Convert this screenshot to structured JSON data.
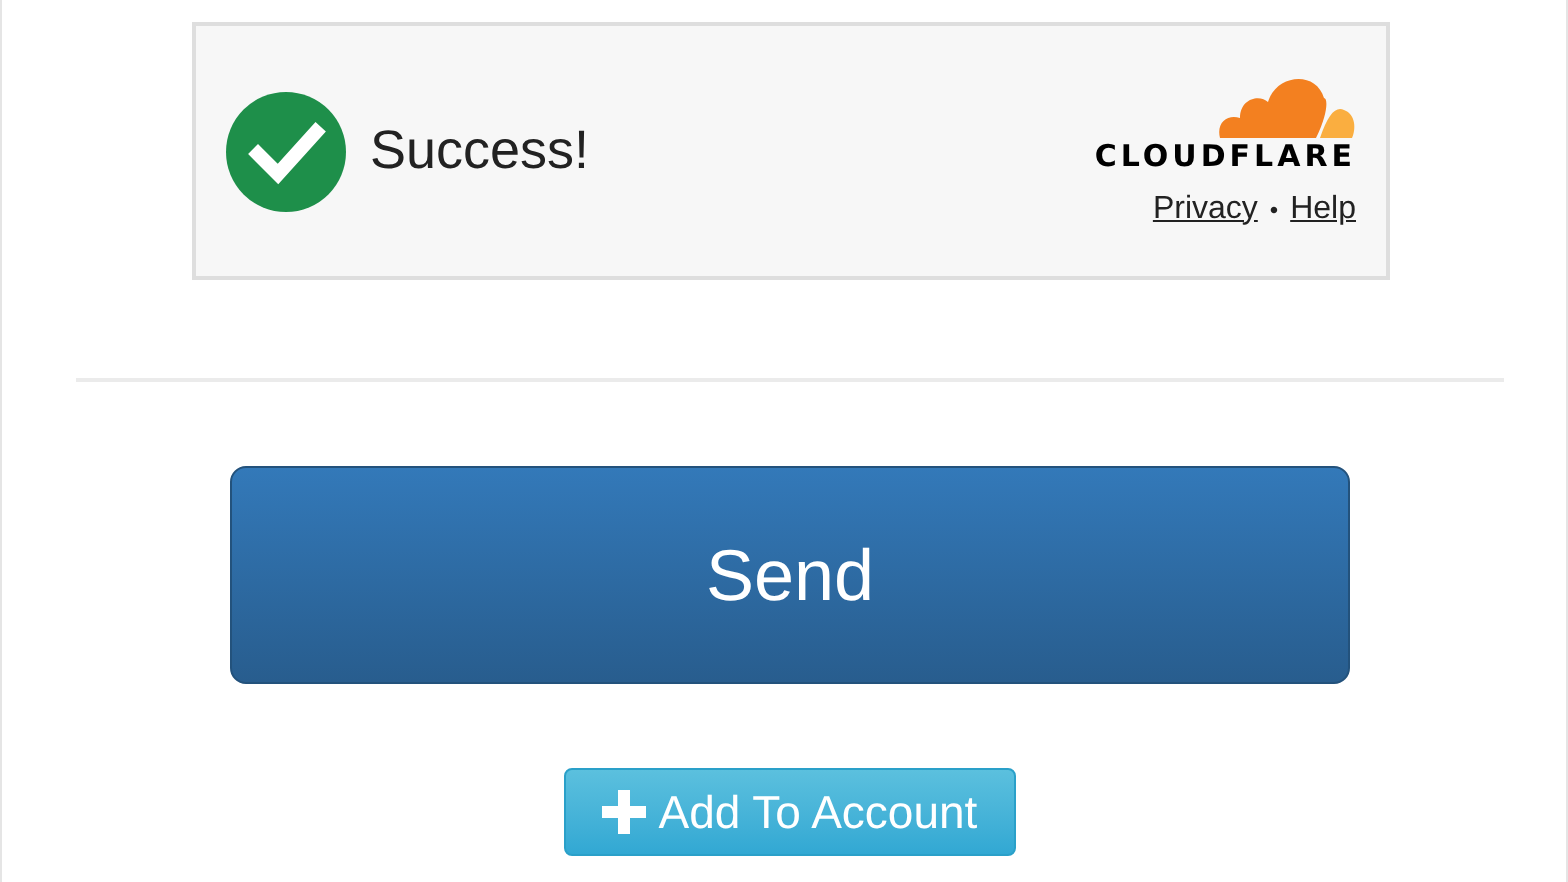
{
  "captcha_widget": {
    "status": "Success!",
    "brand": "CLOUDFLARE",
    "links": [
      "Privacy",
      "Help"
    ],
    "separator": "•"
  },
  "send_button": "Send",
  "add_button": "Add To Account"
}
